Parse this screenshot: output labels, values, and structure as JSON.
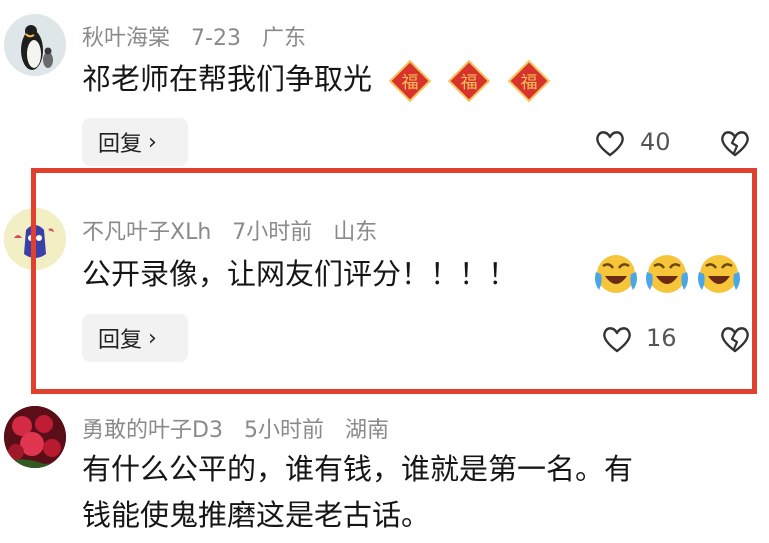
{
  "comments": [
    {
      "username": "秋叶海棠",
      "date": "7-23",
      "location": "广东",
      "text": "祁老师在帮我们争取光",
      "reply_label": "回复",
      "likes": "40",
      "emojis": [
        "fu-icon",
        "fu-icon",
        "fu-icon"
      ]
    },
    {
      "username": "不凡叶子XLh",
      "date": "7小时前",
      "location": "山东",
      "text": "公开录像，让网友们评分！！！！",
      "reply_label": "回复",
      "likes": "16",
      "emojis": [
        "laughing-crying-emoji",
        "laughing-crying-emoji",
        "laughing-crying-emoji"
      ]
    },
    {
      "username": "勇敢的叶子D3",
      "date": "5小时前",
      "location": "湖南",
      "text_line1": "有什么公平的，谁有钱，谁就是第一名。有",
      "text_line2": "钱能使鬼推磨这是老古话。"
    }
  ],
  "colors": {
    "highlight": "#e0412e",
    "meta_text": "#8a8a8a",
    "reply_bg": "#f2f2f2",
    "fu_red": "#d8322c",
    "fu_gold": "#f3c25a"
  }
}
